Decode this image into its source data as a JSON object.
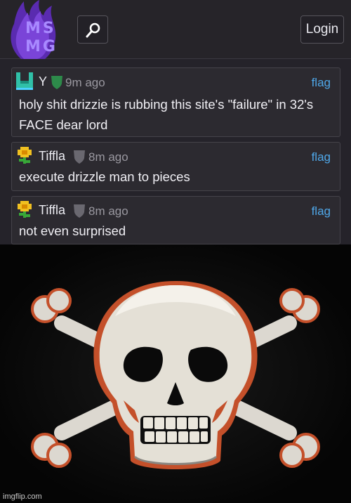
{
  "header": {
    "logo_lines": [
      "MS",
      "MG"
    ],
    "login_label": "Login",
    "search_icon": "search-icon",
    "accent_color": "#a889ff"
  },
  "comments": [
    {
      "username": "Y",
      "avatar_icon": "pixel-avatar-icon",
      "badge_icon": "shield-badge-icon",
      "time": "9m ago",
      "flag": "flag",
      "text": "holy shit drizzie is rubbing this site's \"failure\" in 32's FACE dear lord"
    },
    {
      "username": "Tiffla",
      "avatar_icon": "flower-avatar-icon",
      "badge_icon": "shield-badge-icon",
      "time": "8m ago",
      "flag": "flag",
      "text": "execute drizzle man to pieces"
    },
    {
      "username": "Tiffla",
      "avatar_icon": "flower-avatar-icon",
      "badge_icon": "shield-badge-icon",
      "time": "8m ago",
      "flag": "flag",
      "text": "not even surprised"
    }
  ],
  "image": {
    "subject": "skull-and-crossbones",
    "watermark": "imgflip.com"
  }
}
